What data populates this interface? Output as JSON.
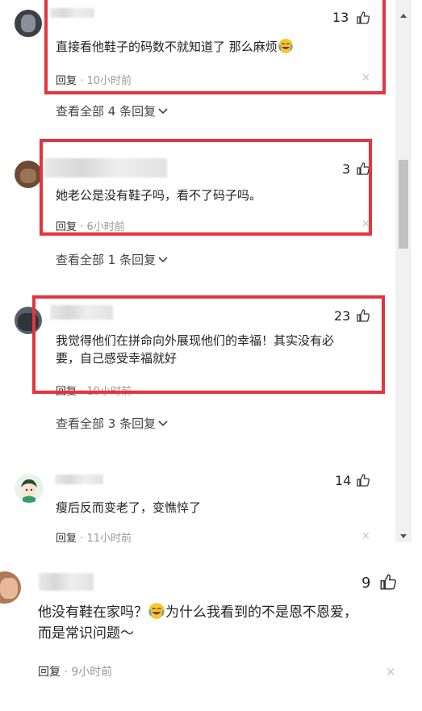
{
  "comments": [
    {
      "likes": "13",
      "text": "直接看他鞋子的码数不就知道了 那么麻烦",
      "reply_label": "回复",
      "time": "10小时前",
      "view_all": "查看全部 4 条回复"
    },
    {
      "likes": "3",
      "text": "她老公是没有鞋子吗，看不了码子吗。",
      "reply_label": "回复",
      "time": "6小时前",
      "view_all": "查看全部 1 条回复"
    },
    {
      "likes": "23",
      "text_line1": "我觉得他们在拼命向外展现他们的幸福！其实没有必",
      "text_line2": "要，自己感受幸福就好",
      "reply_label": "回复",
      "time": "10小时前",
      "view_all": "查看全部 3 条回复"
    },
    {
      "likes": "14",
      "text": "瘦后反而变老了，变憔悴了",
      "reply_label": "回复",
      "time": "11小时前"
    },
    {
      "likes": "9",
      "text_line1_a": "他没有鞋在家吗？",
      "text_line1_b": "为什么我看到的不是恩不恩爱，",
      "text_line2": "而是常识问题～",
      "reply_label": "回复",
      "time": "9小时前"
    }
  ],
  "separator": "·",
  "close_glyph": "×",
  "icons": {
    "like": "thumbs-up-icon",
    "close": "close-icon",
    "emoji": "crying-laughing-emoji"
  },
  "colors": {
    "highlight": "#e5343e",
    "meta": "#999999"
  }
}
